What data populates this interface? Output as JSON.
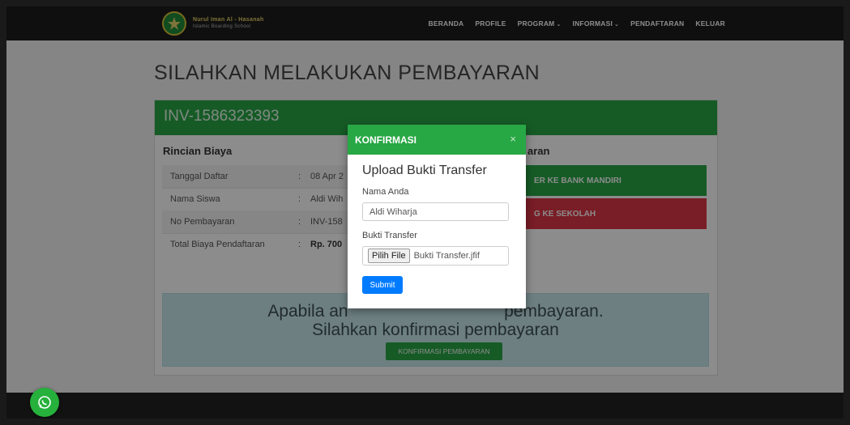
{
  "brand": {
    "line1": "Nurul Iman Al - Hasanah",
    "line2": "Islamic Boarding School",
    "logo_icon": "school-logo-icon"
  },
  "nav": {
    "items": [
      "BERANDA",
      "PROFILE",
      "PROGRAM",
      "INFORMASI",
      "PENDAFTARAN",
      "KELUAR"
    ],
    "dropdown_caret": "⌄"
  },
  "page": {
    "title": "SILAHKAN MELAKUKAN PEMBAYARAN"
  },
  "invoice": {
    "number": "INV-1586323393"
  },
  "rincian": {
    "title": "Rincian Biaya",
    "separator": ":",
    "rows": [
      {
        "label": "Tanggal Daftar",
        "value": "08 Apr 2"
      },
      {
        "label": "Nama Siswa",
        "value": "Aldi Wih"
      },
      {
        "label": "No Pembayaran",
        "value": "INV-158"
      },
      {
        "label": "Total Biaya Pendaftaran",
        "value": "Rp. 700"
      }
    ]
  },
  "pembayaran": {
    "title_partial": "aran",
    "options": [
      {
        "label": "ER KE BANK MANDIRI",
        "color": "#28a745"
      },
      {
        "label": "G KE SEKOLAH",
        "color": "#dc3545"
      }
    ]
  },
  "info": {
    "line1": "Apabila an                                 pembayaran.",
    "line2": "Silahkan konfirmasi pembayaran",
    "button": "KONFIRMASI PEMBAYARAN"
  },
  "modal": {
    "title": "KONFIRMASI",
    "close": "×",
    "heading": "Upload Bukti Transfer",
    "name_label": "Nama Anda",
    "name_value": "Aldi Wiharja",
    "file_label": "Bukti Transfer",
    "file_button": "Pilih File",
    "file_name": "Bukti Transfer.jfif",
    "submit": "Submit"
  },
  "colors": {
    "accent_green": "#28a745",
    "danger_red": "#dc3545",
    "primary_blue": "#007bff",
    "info_bg": "#c7e8ec"
  },
  "whatsapp": {
    "icon": "whatsapp-icon"
  }
}
